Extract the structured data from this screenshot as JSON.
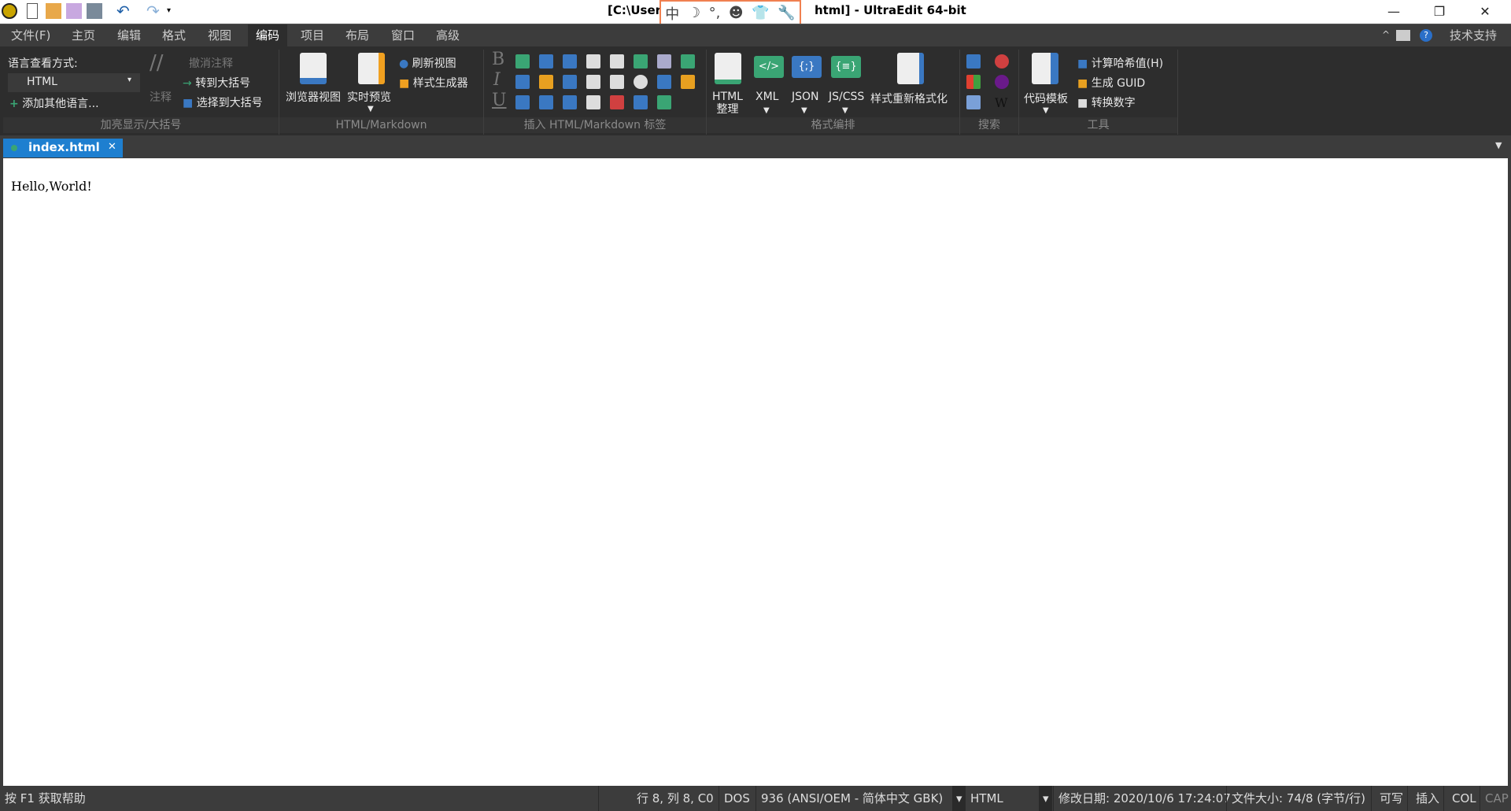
{
  "title": "[C:\\Users… .html] - UltraEdit 64-bit",
  "title_left": "[C:\\Users",
  "title_right": "html] - UltraEdit 64-bit",
  "ime": [
    "中",
    "☽",
    "°,",
    "☻",
    "👕",
    "🔧"
  ],
  "window_controls": {
    "minimize": "—",
    "restore": "❐",
    "close": "✕"
  },
  "menu": [
    "文件(F)",
    "主页",
    "编辑",
    "格式",
    "视图",
    "编码",
    "项目",
    "布局",
    "窗口",
    "高级"
  ],
  "menu_active": "编码",
  "menu_right": {
    "support": "技术支持"
  },
  "ribbon": {
    "g1": {
      "label": "加亮显示/大括号",
      "lang_view": "语言查看方式:",
      "lang_value": "HTML",
      "add_lang": "添加其他语言...",
      "comment": "注释",
      "uncomment": "撤消注释",
      "goto_brace": "转到大括号",
      "select_brace": "选择到大括号"
    },
    "g2": {
      "label": "HTML/Markdown",
      "browser_view": "浏览器视图",
      "live_preview": "实时预览",
      "refresh_view": "刷新视图",
      "style_builder": "样式生成器"
    },
    "g3": {
      "label": "插入 HTML/Markdown 标签"
    },
    "g4": {
      "label": "格式编排",
      "html_tidy": "HTML",
      "html_tidy2": "整理",
      "xml": "XML",
      "json": "JSON",
      "jscss": "JS/CSS",
      "reformat": "样式重新格式化"
    },
    "g5": {
      "label": "搜索"
    },
    "g6": {
      "label": "工具",
      "code_template": "代码模板",
      "hash": "计算哈希值(H)",
      "guid": "生成 GUID",
      "convert": "转换数字"
    }
  },
  "tab": {
    "name": "index.html",
    "close": "✕"
  },
  "editor": {
    "content": "Hello,World!"
  },
  "status": {
    "help": "按 F1 获取帮助",
    "position": "行 8, 列 8, C0",
    "line_ending": "DOS",
    "codepage": "936  (ANSI/OEM - 简体中文 GBK)",
    "syntax": "HTML",
    "modified": "修改日期: 2020/10/6 17:24:07",
    "filesize": "文件大小: 74/8 (字节/行)",
    "writable": "可写",
    "insert": "插入",
    "col": "COL",
    "cap": "CAP"
  },
  "colors": {
    "accent": "#1e7fd0",
    "ribbon_bg": "#2d2d2d",
    "green": "#3aa574",
    "blue": "#3a78c2"
  }
}
